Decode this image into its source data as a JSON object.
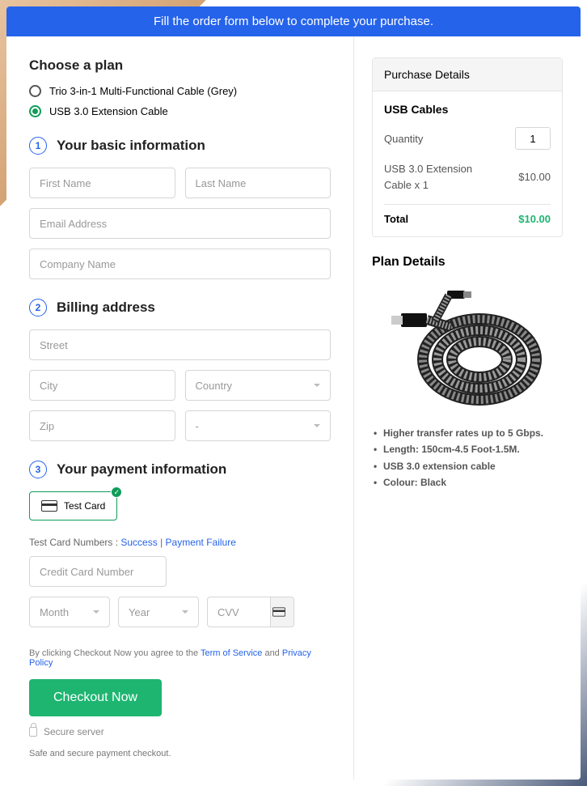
{
  "banner": "Fill the order form below to complete your purchase.",
  "left": {
    "choose_plan": "Choose a plan",
    "plans": [
      {
        "label": "Trio 3-in-1 Multi-Functional Cable (Grey)",
        "selected": false
      },
      {
        "label": "USB 3.0 Extension Cable",
        "selected": true
      }
    ],
    "steps": {
      "basic": {
        "num": "1",
        "title": "Your basic information"
      },
      "billing": {
        "num": "2",
        "title": "Billing address"
      },
      "payment": {
        "num": "3",
        "title": "Your payment information"
      }
    },
    "placeholders": {
      "first_name": "First Name",
      "last_name": "Last Name",
      "email": "Email Address",
      "company": "Company Name",
      "street": "Street",
      "city": "City",
      "country": "Country",
      "zip": "Zip",
      "state": "-",
      "cc": "Credit Card Number",
      "month": "Month",
      "year": "Year",
      "cvv": "CVV"
    },
    "test_card_label": "Test Card",
    "test_links": {
      "prefix": "Test Card Numbers : ",
      "success": "Success",
      "sep": " | ",
      "fail": "Payment Failure"
    },
    "terms": {
      "prefix": "By clicking Checkout Now you agree to the ",
      "tos": "Term of Service",
      "and": " and ",
      "privacy": "Privacy Policy"
    },
    "checkout": "Checkout Now",
    "secure": "Secure server",
    "safe": "Safe and secure payment checkout."
  },
  "right": {
    "purchase_title": "Purchase Details",
    "product_name": "USB Cables",
    "qty_label": "Quantity",
    "qty_value": "1",
    "ext_label": "USB 3.0 Extension Cable x 1",
    "ext_price": "$10.00",
    "total_label": "Total",
    "total_price": "$10.00",
    "plan_details": "Plan Details",
    "bullets": [
      "Higher transfer rates up to 5 Gbps.",
      "Length: 150cm-4.5 Foot-1.5M.",
      "USB 3.0 extension cable",
      "Colour: Black"
    ]
  }
}
